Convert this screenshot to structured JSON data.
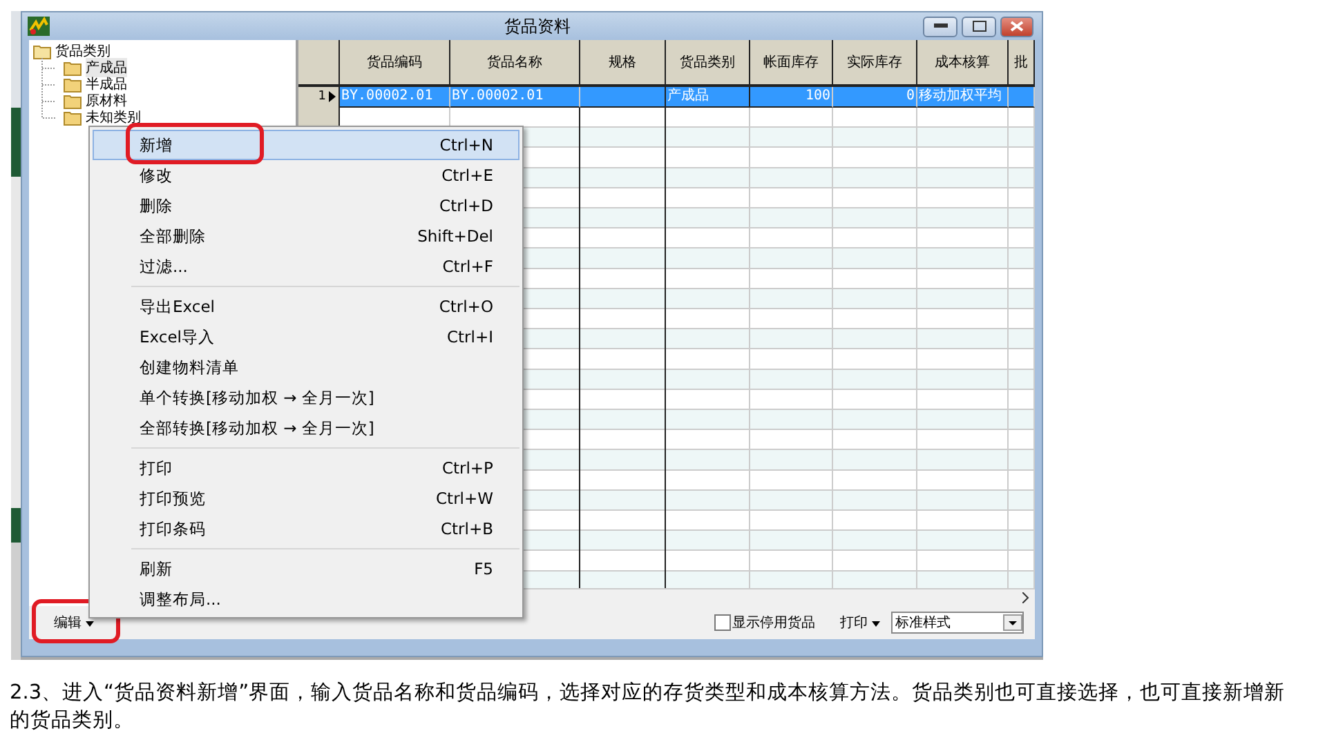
{
  "window": {
    "title": "货品资料"
  },
  "tree": {
    "label": "货品类别",
    "expanded": true,
    "children": [
      {
        "label": "产成品",
        "selected": true
      },
      {
        "label": "半成品",
        "selected": false
      },
      {
        "label": "原材料",
        "selected": false
      },
      {
        "label": "未知类别",
        "selected": false
      }
    ]
  },
  "table": {
    "columns": [
      "货品编码",
      "货品名称",
      "规格",
      "货品类别",
      "帐面库存",
      "实际库存",
      "成本核算",
      "批"
    ],
    "rows": [
      {
        "number": "1",
        "selected": true,
        "cells": [
          "BY.00002.01",
          "BY.00002.01",
          "",
          "产成品",
          "100",
          "0",
          "移动加权平均",
          ""
        ]
      }
    ]
  },
  "context_menu": {
    "items": [
      {
        "kind": "item",
        "label": "新增",
        "shortcut": "Ctrl+N",
        "selected": true,
        "annotated": true
      },
      {
        "kind": "item",
        "label": "修改",
        "shortcut": "Ctrl+E",
        "selected": false
      },
      {
        "kind": "item",
        "label": "删除",
        "shortcut": "Ctrl+D",
        "selected": false
      },
      {
        "kind": "item",
        "label": "全部删除",
        "shortcut": "Shift+Del",
        "selected": false
      },
      {
        "kind": "item",
        "label": "过滤...",
        "shortcut": "Ctrl+F",
        "selected": false
      },
      {
        "kind": "separator"
      },
      {
        "kind": "item",
        "label": "导出Excel",
        "shortcut": "Ctrl+O",
        "selected": false
      },
      {
        "kind": "item",
        "label": "Excel导入",
        "shortcut": "Ctrl+I",
        "selected": false
      },
      {
        "kind": "item",
        "label": "创建物料清单",
        "selected": false
      },
      {
        "kind": "item",
        "label": "单个转换[移动加权 → 全月一次]",
        "selected": false
      },
      {
        "kind": "item",
        "label": "全部转换[移动加权 → 全月一次]",
        "selected": false
      },
      {
        "kind": "separator"
      },
      {
        "kind": "item",
        "label": "打印",
        "shortcut": "Ctrl+P",
        "selected": false
      },
      {
        "kind": "item",
        "label": "打印预览",
        "shortcut": "Ctrl+W",
        "selected": false
      },
      {
        "kind": "item",
        "label": "打印条码",
        "shortcut": "Ctrl+B",
        "selected": false
      },
      {
        "kind": "separator"
      },
      {
        "kind": "item",
        "label": "刷新",
        "shortcut": "F5",
        "selected": false
      },
      {
        "kind": "item",
        "label": "调整布局...",
        "selected": false
      }
    ]
  },
  "bottom_bar": {
    "edit_button": {
      "label": "编辑",
      "annotated": true
    },
    "show_disabled": {
      "label": "显示停用货品",
      "checked": false
    },
    "print_button": "打印",
    "style_select": "标准样式"
  },
  "caption": "2.3、进入“货品资料新增”界面，输入货品名称和货品编码，选择对应的存货类型和成本核算方法。货品类别也可直接选择，也可直接新增新的货品类别。"
}
